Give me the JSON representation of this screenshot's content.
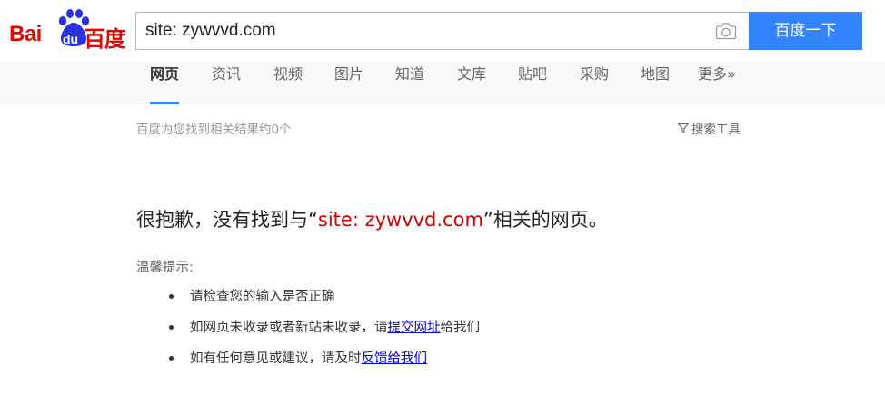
{
  "header": {
    "logo": {
      "latin": "Bai",
      "du": "du",
      "chinese": "百度"
    },
    "search": {
      "value": "site: zywvvd.com"
    },
    "search_button": "百度一下",
    "camera_icon": "camera-icon"
  },
  "tabs": [
    {
      "label": "网页",
      "active": true
    },
    {
      "label": "资讯"
    },
    {
      "label": "视频"
    },
    {
      "label": "图片"
    },
    {
      "label": "知道"
    },
    {
      "label": "文库"
    },
    {
      "label": "贴吧"
    },
    {
      "label": "采购"
    },
    {
      "label": "地图"
    },
    {
      "label": "更多»"
    }
  ],
  "results": {
    "count_text": "百度为您找到相关结果约0个",
    "tools_label": "搜索工具"
  },
  "no_result": {
    "prefix": "很抱歉，没有找到与“",
    "query": "site: zywvvd.com",
    "suffix": "”相关的网页。"
  },
  "tips": {
    "title": "温馨提示:",
    "items": [
      {
        "text": "请检查您的输入是否正确"
      },
      {
        "before": "如网页未收录或者新站未收录，请",
        "link": "提交网址",
        "after": "给我们"
      },
      {
        "before": "如有任何意见或建议，请及时",
        "link": "反馈给我们",
        "after": ""
      }
    ]
  },
  "colors": {
    "accent": "#3385ff",
    "brand_red": "#e10602",
    "brand_blue": "#2932e1",
    "query_red": "#cc0000",
    "link": "#0000cc"
  }
}
